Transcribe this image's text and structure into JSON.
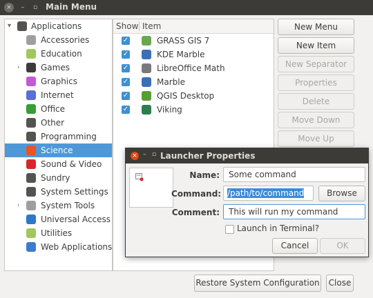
{
  "window": {
    "title": "Main Menu",
    "close_glyph": "×",
    "min_glyph": "–",
    "max_glyph": "▫"
  },
  "tree": {
    "root": {
      "label": "Applications",
      "arrow": "▾",
      "icon": "apps-grid-icon"
    },
    "items": [
      {
        "label": "Accessories",
        "icon": "accessories-icon",
        "color": "#9e9e9e"
      },
      {
        "label": "Education",
        "icon": "education-icon",
        "color": "#a0c85a"
      },
      {
        "label": "Games",
        "icon": "games-icon",
        "color": "#3c3b37",
        "arrow": "›"
      },
      {
        "label": "Graphics",
        "icon": "graphics-icon",
        "color": "#c15bd4"
      },
      {
        "label": "Internet",
        "icon": "internet-icon",
        "color": "#5b6fd6"
      },
      {
        "label": "Office",
        "icon": "office-icon",
        "color": "#3a9b3a"
      },
      {
        "label": "Other",
        "icon": "other-icon",
        "color": "#55534f"
      },
      {
        "label": "Programming",
        "icon": "programming-icon",
        "color": "#55534f"
      },
      {
        "label": "Science",
        "icon": "science-icon",
        "color": "#e95420",
        "selected": true
      },
      {
        "label": "Sound & Video",
        "icon": "sound-video-icon",
        "color": "#d8262a"
      },
      {
        "label": "Sundry",
        "icon": "sundry-icon",
        "color": "#55534f"
      },
      {
        "label": "System Settings",
        "icon": "system-settings-icon",
        "color": "#55534f"
      },
      {
        "label": "System Tools",
        "icon": "system-tools-icon",
        "color": "#9e9e9e",
        "arrow": "›"
      },
      {
        "label": "Universal Access",
        "icon": "universal-access-icon",
        "color": "#2f78c8"
      },
      {
        "label": "Utilities",
        "icon": "utilities-icon",
        "color": "#a0c85a"
      },
      {
        "label": "Web Applications",
        "icon": "web-applications-icon",
        "color": "#3b7bd0"
      }
    ]
  },
  "list": {
    "header": {
      "show": "Show",
      "item": "Item"
    },
    "check_glyph": "✓",
    "rows": [
      {
        "label": "GRASS GIS 7",
        "icon": "grass-gis-icon",
        "color": "#6aa84f",
        "checked": true
      },
      {
        "label": "KDE Marble",
        "icon": "kde-marble-icon",
        "color": "#3b6fb6",
        "checked": true
      },
      {
        "label": "LibreOffice Math",
        "icon": "libreoffice-math-icon",
        "color": "#7a7a7a",
        "checked": true
      },
      {
        "label": "Marble",
        "icon": "marble-icon",
        "color": "#3b6fb6",
        "checked": true
      },
      {
        "label": "QGIS Desktop",
        "icon": "qgis-icon",
        "color": "#5a9e2f",
        "checked": true
      },
      {
        "label": "Viking",
        "icon": "viking-icon",
        "color": "#2e7d4f",
        "checked": true
      }
    ]
  },
  "side_buttons": {
    "new_menu": "New Menu",
    "new_item": "New Item",
    "new_separator": "New Separator",
    "properties": "Properties",
    "delete": "Delete",
    "move_down": "Move Down",
    "move_up": "Move Up"
  },
  "bottom": {
    "restore": "Restore System Configuration",
    "close": "Close"
  },
  "dialog": {
    "title": "Launcher Properties",
    "close_glyph": "×",
    "name_label": "Name:",
    "name_value": "Some command",
    "command_label": "Command:",
    "command_value": "/path/to/command",
    "browse": "Browse",
    "comment_label": "Comment:",
    "comment_value": "This will run my command",
    "terminal_label": "Launch in Terminal?",
    "cancel": "Cancel",
    "ok": "OK"
  },
  "colors": {
    "accent": "#4f98d8",
    "titlebar": "#3c3b37",
    "close": "#df4a16"
  }
}
